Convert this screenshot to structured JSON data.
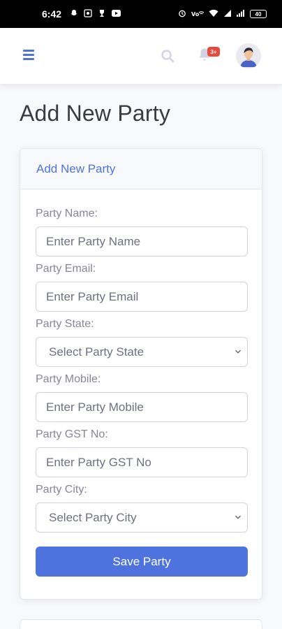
{
  "status_bar": {
    "time": "6:42",
    "battery": "40",
    "icons_left": [
      "snapchat-icon",
      "photo-icon",
      "trophy-icon",
      "youtube-icon"
    ],
    "icons_right": [
      "alarm-icon",
      "vowifi-icon",
      "wifi-icon",
      "mobile-signal-icon",
      "signal-bars-icon",
      "battery-icon"
    ]
  },
  "topbar": {
    "notification_count": "3+",
    "accent_color": "#4e73df",
    "badge_color": "#e74a3b"
  },
  "page": {
    "title": "Add New Party"
  },
  "card": {
    "header": "Add New Party",
    "fields": {
      "name": {
        "label": "Party Name:",
        "placeholder": "Enter Party Name"
      },
      "email": {
        "label": "Party Email:",
        "placeholder": "Enter Party Email"
      },
      "state": {
        "label": "Party State:",
        "selected": "Select Party State"
      },
      "mobile": {
        "label": "Party Mobile:",
        "placeholder": "Enter Party Mobile"
      },
      "gst": {
        "label": "Party GST No:",
        "placeholder": "Enter Party GST No"
      },
      "city": {
        "label": "Party City:",
        "selected": "Select Party City"
      }
    },
    "save_label": "Save Party"
  }
}
